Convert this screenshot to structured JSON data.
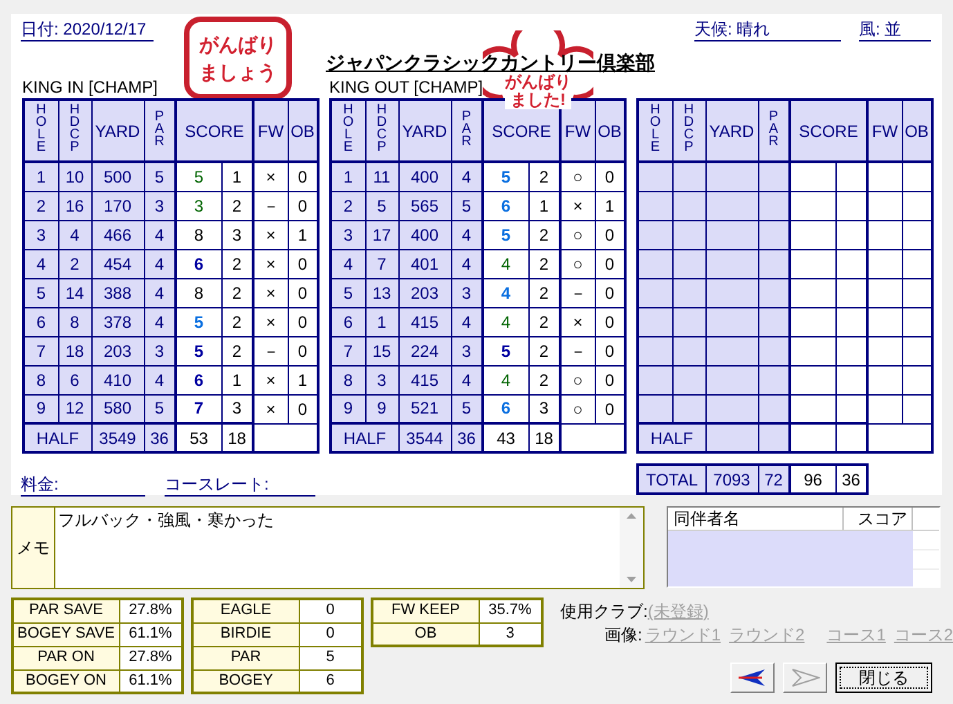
{
  "date": "日付: 2020/12/17",
  "weather": "天候: 晴れ",
  "wind": "風: 並",
  "title": "ジャパンクラシックカントリー倶楽部",
  "stickers": [
    {
      "kind": "square",
      "text": "がんばりましょう"
    },
    {
      "kind": "flower",
      "text": "がんばりました!"
    }
  ],
  "courses": [
    {
      "name": "KING IN [CHAMP]",
      "columns": [
        "HOLE",
        "HDCP",
        "YARD",
        "PAR",
        "SCORE",
        "FW",
        "OB"
      ],
      "rows": [
        {
          "hole": "1",
          "hdcp": "10",
          "yard": "500",
          "par": "5",
          "score": "5",
          "kind": "par",
          "putts": "1",
          "fw": "×",
          "ob": "0"
        },
        {
          "hole": "2",
          "hdcp": "16",
          "yard": "170",
          "par": "3",
          "score": "3",
          "kind": "par",
          "putts": "2",
          "fw": "－",
          "ob": "0"
        },
        {
          "hole": "3",
          "hdcp": "4",
          "yard": "466",
          "par": "4",
          "score": "8",
          "kind": "other",
          "putts": "3",
          "fw": "×",
          "ob": "1"
        },
        {
          "hole": "4",
          "hdcp": "2",
          "yard": "454",
          "par": "4",
          "score": "6",
          "kind": "double",
          "putts": "2",
          "fw": "×",
          "ob": "0"
        },
        {
          "hole": "5",
          "hdcp": "14",
          "yard": "388",
          "par": "4",
          "score": "8",
          "kind": "other",
          "putts": "2",
          "fw": "×",
          "ob": "0"
        },
        {
          "hole": "6",
          "hdcp": "8",
          "yard": "378",
          "par": "4",
          "score": "5",
          "kind": "bogey",
          "putts": "2",
          "fw": "×",
          "ob": "0"
        },
        {
          "hole": "7",
          "hdcp": "18",
          "yard": "203",
          "par": "3",
          "score": "5",
          "kind": "double",
          "putts": "2",
          "fw": "－",
          "ob": "0"
        },
        {
          "hole": "8",
          "hdcp": "6",
          "yard": "410",
          "par": "4",
          "score": "6",
          "kind": "double",
          "putts": "1",
          "fw": "×",
          "ob": "1"
        },
        {
          "hole": "9",
          "hdcp": "12",
          "yard": "580",
          "par": "5",
          "score": "7",
          "kind": "double",
          "putts": "3",
          "fw": "×",
          "ob": "0"
        }
      ],
      "half": {
        "label": "HALF",
        "yard": "3549",
        "par": "36",
        "score": "53",
        "putts": "18"
      }
    },
    {
      "name": "KING OUT [CHAMP]",
      "columns": [
        "HOLE",
        "HDCP",
        "YARD",
        "PAR",
        "SCORE",
        "FW",
        "OB"
      ],
      "rows": [
        {
          "hole": "1",
          "hdcp": "11",
          "yard": "400",
          "par": "4",
          "score": "5",
          "kind": "bogey",
          "putts": "2",
          "fw": "○",
          "ob": "0"
        },
        {
          "hole": "2",
          "hdcp": "5",
          "yard": "565",
          "par": "5",
          "score": "6",
          "kind": "bogey",
          "putts": "1",
          "fw": "×",
          "ob": "1"
        },
        {
          "hole": "3",
          "hdcp": "17",
          "yard": "400",
          "par": "4",
          "score": "5",
          "kind": "bogey",
          "putts": "2",
          "fw": "○",
          "ob": "0"
        },
        {
          "hole": "4",
          "hdcp": "7",
          "yard": "401",
          "par": "4",
          "score": "4",
          "kind": "par",
          "putts": "2",
          "fw": "○",
          "ob": "0"
        },
        {
          "hole": "5",
          "hdcp": "13",
          "yard": "203",
          "par": "3",
          "score": "4",
          "kind": "bogey",
          "putts": "2",
          "fw": "－",
          "ob": "0"
        },
        {
          "hole": "6",
          "hdcp": "1",
          "yard": "415",
          "par": "4",
          "score": "4",
          "kind": "par",
          "putts": "2",
          "fw": "×",
          "ob": "0"
        },
        {
          "hole": "7",
          "hdcp": "15",
          "yard": "224",
          "par": "3",
          "score": "5",
          "kind": "double",
          "putts": "2",
          "fw": "－",
          "ob": "0"
        },
        {
          "hole": "8",
          "hdcp": "3",
          "yard": "415",
          "par": "4",
          "score": "4",
          "kind": "par",
          "putts": "2",
          "fw": "○",
          "ob": "0"
        },
        {
          "hole": "9",
          "hdcp": "9",
          "yard": "521",
          "par": "5",
          "score": "6",
          "kind": "bogey",
          "putts": "3",
          "fw": "○",
          "ob": "0"
        }
      ],
      "half": {
        "label": "HALF",
        "yard": "3544",
        "par": "36",
        "score": "43",
        "putts": "18"
      }
    },
    {
      "columns": [
        "HOLE",
        "HDCP",
        "YARD",
        "PAR",
        "SCORE",
        "FW",
        "OB"
      ],
      "half": {
        "label": "HALF"
      }
    }
  ],
  "total": {
    "label": "TOTAL",
    "yard": "7093",
    "par": "72",
    "score": "96",
    "putts": "36"
  },
  "fee": "料金:",
  "course_rate": "コースレート:",
  "memo": {
    "label": "メモ",
    "value": "フルバック・強風・寒かった"
  },
  "companions": {
    "columns": [
      "同伴者名",
      "スコア"
    ]
  },
  "stats": [
    [
      {
        "label": "PAR SAVE",
        "value": "27.8%"
      },
      {
        "label": "BOGEY SAVE",
        "value": "61.1%"
      },
      {
        "label": "PAR ON",
        "value": "27.8%"
      },
      {
        "label": "BOGEY ON",
        "value": "61.1%"
      }
    ],
    [
      {
        "label": "EAGLE",
        "value": "0"
      },
      {
        "label": "BIRDIE",
        "value": "0"
      },
      {
        "label": "PAR",
        "value": "5"
      },
      {
        "label": "BOGEY",
        "value": "6"
      }
    ],
    [
      {
        "label": "FW KEEP",
        "value": "35.7%"
      },
      {
        "label": "OB",
        "value": "3"
      }
    ]
  ],
  "club": {
    "label": "使用クラブ:",
    "link": "(未登録)"
  },
  "images": {
    "label": "画像:",
    "links": [
      "ラウンド1",
      "ラウンド2",
      "コース1",
      "コース2"
    ]
  },
  "buttons": [
    {
      "kind": "prev",
      "disabled": false
    },
    {
      "kind": "next",
      "disabled": true
    },
    {
      "kind": "close",
      "label": "閉じる"
    }
  ]
}
